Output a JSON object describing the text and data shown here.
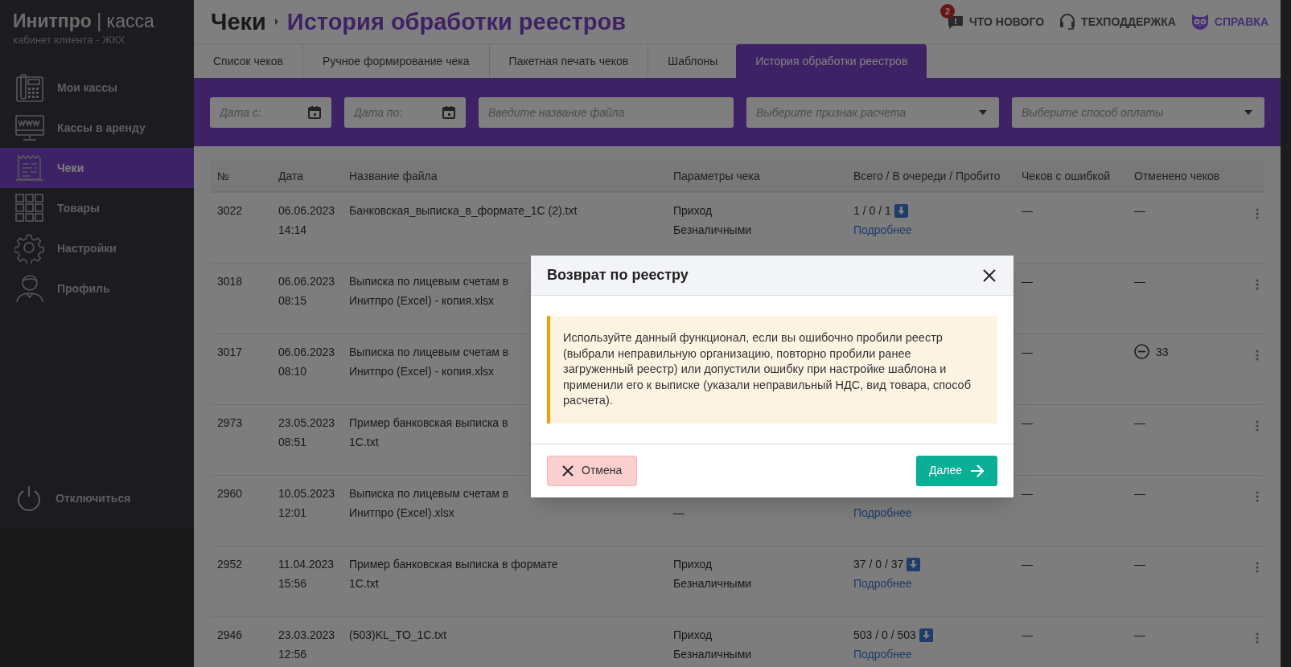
{
  "sidebar": {
    "brand": "**Инитпро** | касса",
    "subtitle": "кабинет клиента - ЖКХ",
    "items": [
      {
        "label": "Мои кассы",
        "selected": false
      },
      {
        "label": "Кассы в аренду",
        "selected": false
      },
      {
        "label": "Чеки",
        "selected": true
      },
      {
        "label": "Товары",
        "selected": false
      },
      {
        "label": "Настройки",
        "selected": false
      },
      {
        "label": "Профиль",
        "selected": false
      }
    ],
    "logout": "Отключиться"
  },
  "header": {
    "breadcrumb": [
      "Чеки",
      "История обработки реестров"
    ],
    "links": [
      {
        "kind": "news",
        "label": "ЧТО НОВОГО",
        "badge": "2"
      },
      {
        "kind": "support",
        "label": "ТЕХПОДДЕРЖКА"
      },
      {
        "kind": "help",
        "label": "СПРАВКА"
      }
    ]
  },
  "tabs": [
    {
      "label": "Список чеков",
      "selected": false
    },
    {
      "label": "Ручное формирование чека",
      "selected": false
    },
    {
      "label": "Пакетная печать чеков",
      "selected": false
    },
    {
      "label": "Шаблоны",
      "selected": false
    },
    {
      "label": "История обработки реестров",
      "selected": true
    }
  ],
  "filters": [
    {
      "kind": "date",
      "placeholder": "Дата с:"
    },
    {
      "kind": "date",
      "placeholder": "Дата по:"
    },
    {
      "kind": "text",
      "placeholder": "Введите название файла"
    },
    {
      "kind": "select",
      "placeholder": "Выберите признак расчета"
    },
    {
      "kind": "select",
      "placeholder": "Выберите способ оплаты"
    }
  ],
  "table": {
    "columns": [
      "№",
      "Дата",
      "Название файла",
      "Параметры чека",
      "Всего / В очереди / Пробито",
      "Чеков с ошибкой",
      "Отменено чеков"
    ],
    "rows": [
      {
        "number": "3022",
        "date": "06.06.2023",
        "time": "14:14",
        "file_name": [
          "Банковская_выписка_в_формате_1С (2).txt"
        ],
        "params": {
          "operation": "Приход",
          "payment": "Безналичными"
        },
        "totals": {
          "count": "1 / 0 / 1",
          "link": "Подробнее"
        },
        "errors": "—",
        "cancelled": {
          "kind": "dash",
          "text": "—"
        }
      },
      {
        "number": "3018",
        "date": "06.06.2023",
        "time": "08:15",
        "file_name": [
          "Выписка по лицевым счетам в",
          "Инитпро (Excel) - копия.xlsx"
        ],
        "params": {},
        "totals": {},
        "errors": "—",
        "cancelled": {
          "kind": "dash",
          "text": "—"
        }
      },
      {
        "number": "3017",
        "date": "06.06.2023",
        "time": "08:10",
        "file_name": [
          "Выписка по лицевым счетам в",
          "Инитпро (Excel) - копия.xlsx"
        ],
        "params": {},
        "totals": {},
        "errors": "—",
        "cancelled": {
          "kind": "count",
          "text": "33"
        }
      },
      {
        "number": "2973",
        "date": "23.05.2023",
        "time": "08:51",
        "file_name": [
          "Пример банковская выписка в",
          "1C.txt"
        ],
        "params": {},
        "totals": {},
        "errors": "—",
        "cancelled": {
          "kind": "dash",
          "text": "—"
        }
      },
      {
        "number": "2960",
        "date": "10.05.2023",
        "time": "12:01",
        "file_name": [
          "Выписка по лицевым счетам в",
          "Инитпро (Excel).xlsx"
        ],
        "params": {
          "payment": "—"
        },
        "totals": {
          "link": "Подробнее"
        },
        "errors": "—",
        "cancelled": {
          "kind": "dash",
          "text": "—"
        }
      },
      {
        "number": "2952",
        "date": "11.04.2023",
        "time": "15:56",
        "file_name": [
          "Пример банковская выписка в формате",
          "1C.txt"
        ],
        "params": {
          "operation": "Приход",
          "payment": "Безналичными"
        },
        "totals": {
          "count": "37 / 0 / 37",
          "link": "Подробнее"
        },
        "errors": "—",
        "cancelled": {
          "kind": "dash",
          "text": "—"
        }
      },
      {
        "number": "2946",
        "date": "23.03.2023",
        "time": "12:56",
        "file_name": [
          "(503)KL_TO_1C.txt"
        ],
        "params": {
          "operation": "Приход",
          "payment": "Безналичными"
        },
        "totals": {
          "count": "503 / 0 / 503",
          "link": "Подробнее"
        },
        "errors": "—",
        "cancelled": {
          "kind": "dash",
          "text": "—"
        }
      }
    ]
  },
  "dialog": {
    "title": "Возврат по реестру",
    "message": "Используйте данный функционал, если вы ошибочно пробили реестр (выбрали неправильную организацию, повторно пробили ранее загруженный реестр) или допустили ошибку при настройке шаблона и применили его к выписке (указали неправильный НДС, вид товара, способ расчета).",
    "cancel": "Отмена",
    "next": "Далее"
  }
}
